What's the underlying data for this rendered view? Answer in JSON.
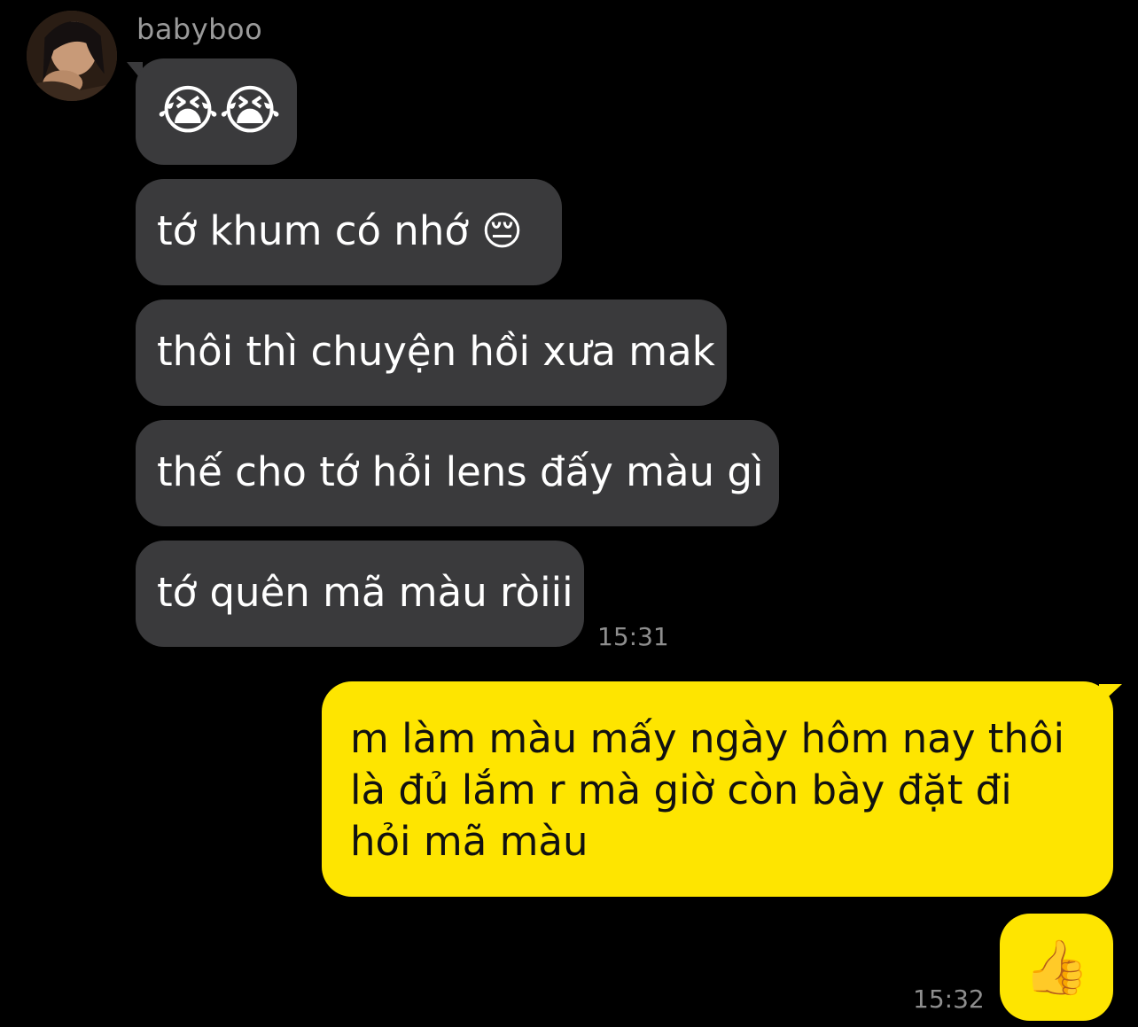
{
  "conversation": {
    "sender": {
      "name": "babyboo",
      "avatar_icon": "profile-photo"
    },
    "incoming": {
      "bubble_color": "#3a3a3c",
      "messages": [
        {
          "text": "😭😭",
          "kind": "emoji"
        },
        {
          "text": "tớ khum có nhớ 😔",
          "kind": "text"
        },
        {
          "text": "thôi thì chuyện hồi xưa mak",
          "kind": "text"
        },
        {
          "text": "thế cho tớ hỏi lens đấy màu gì",
          "kind": "text"
        },
        {
          "text": "tớ quên mã màu ròiii",
          "kind": "text"
        }
      ],
      "time": "15:31"
    },
    "outgoing": {
      "bubble_color": "#fee500",
      "messages": [
        {
          "text": "m làm màu mấy ngày hôm nay thôi là đủ lắm r mà giờ còn bày đặt đi hỏi mã màu",
          "kind": "text"
        },
        {
          "text": "👍",
          "kind": "emoji"
        }
      ],
      "time": "15:32"
    }
  }
}
